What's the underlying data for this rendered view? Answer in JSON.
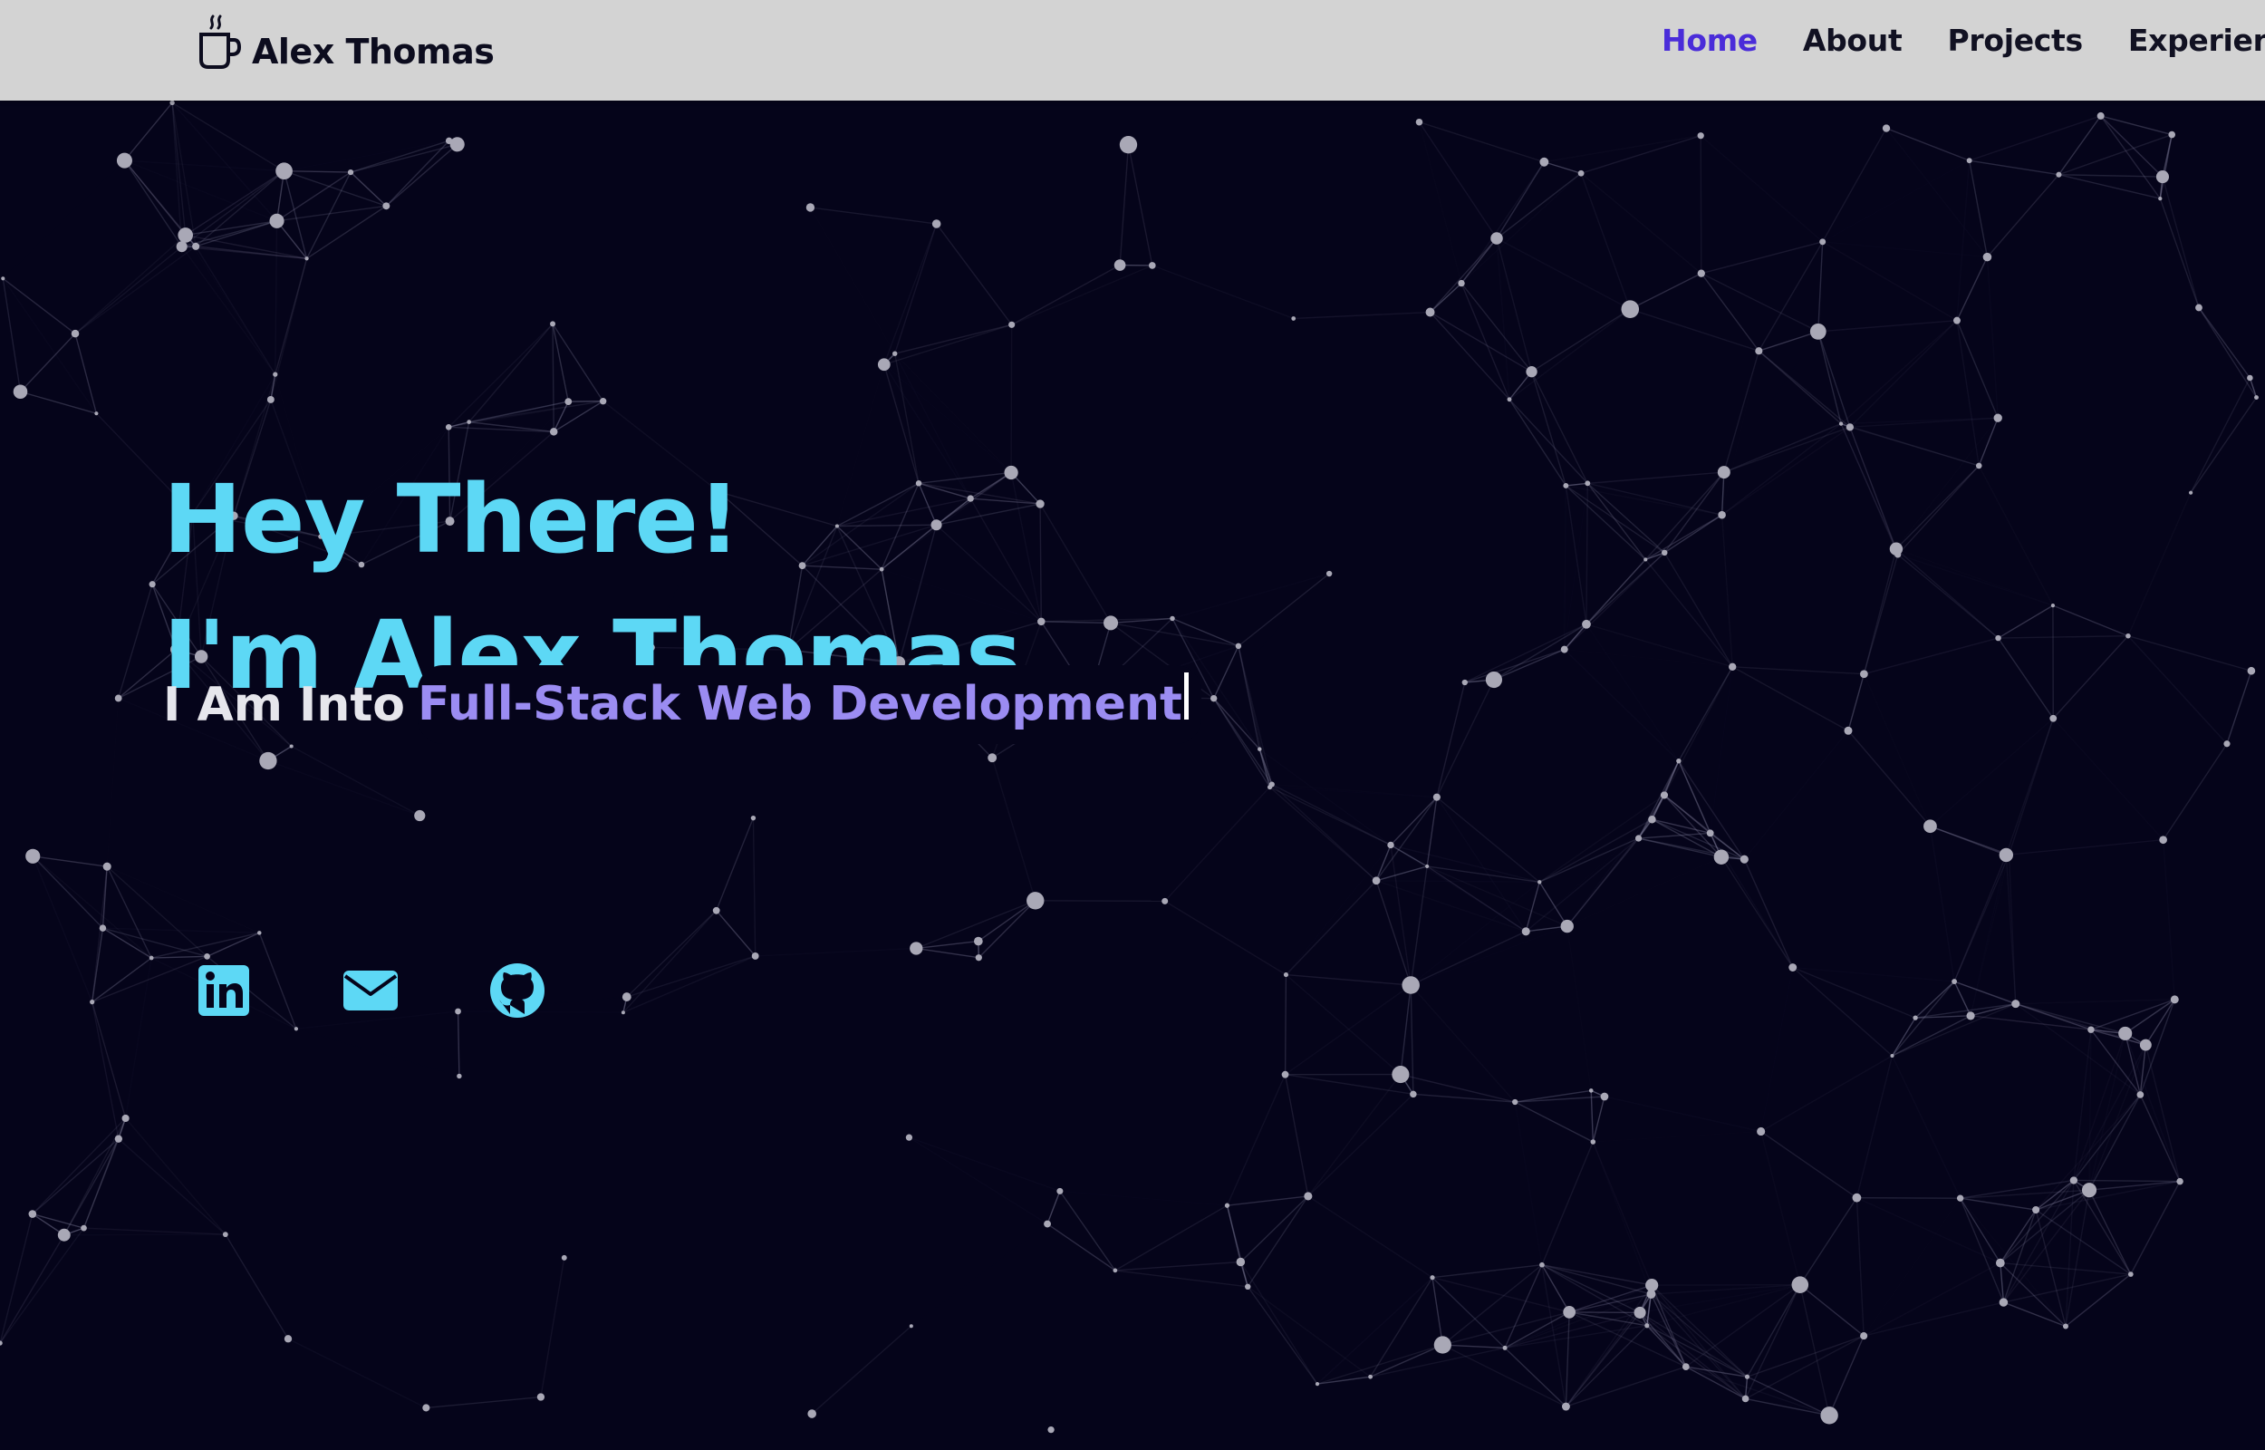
{
  "nav": {
    "brand_name": "Alex Thomas",
    "links": [
      {
        "label": "Home",
        "active": true
      },
      {
        "label": "About",
        "active": false
      },
      {
        "label": "Projects",
        "active": false
      },
      {
        "label": "Experience",
        "active": false
      }
    ]
  },
  "hero": {
    "greeting_line1": "Hey There!",
    "greeting_line2": "I'm Alex Thomas",
    "tagline_prefix": "I Am Into",
    "tagline_typed": "Full-Stack Web Development"
  },
  "socials": [
    {
      "icon": "linkedin-icon"
    },
    {
      "icon": "mail-icon"
    },
    {
      "icon": "github-icon"
    }
  ],
  "colors": {
    "accent_cyan": "#5dd8f5",
    "accent_purple": "#9b8cf2",
    "active_nav": "#4a2cd9",
    "hero_background": "#05041a",
    "navbar_background": "#d3d3d3"
  }
}
